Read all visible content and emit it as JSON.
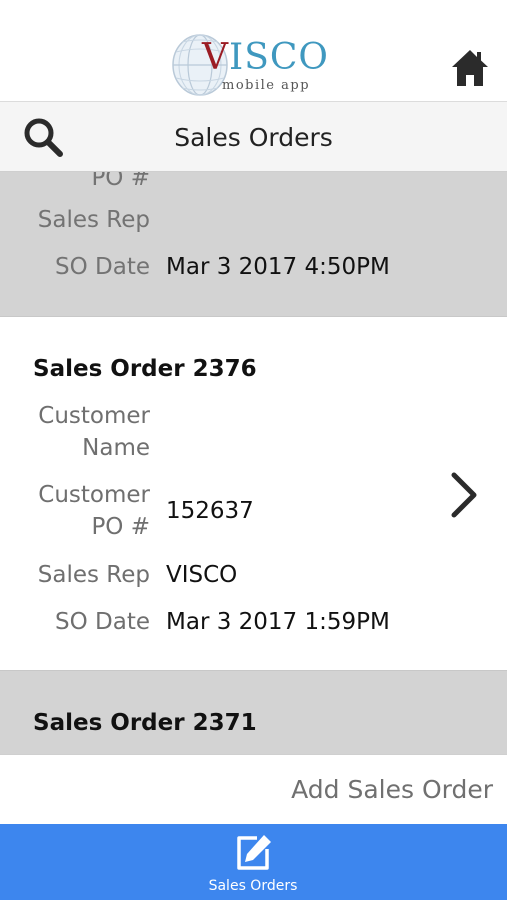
{
  "header": {
    "logo_main_first": "V",
    "logo_main_rest": "ISCO",
    "logo_sub": "mobile app",
    "home_icon": "home-icon"
  },
  "titlebar": {
    "title": "Sales Orders",
    "search_icon": "search-icon"
  },
  "orders": [
    {
      "title": "",
      "labels": {
        "po": "PO #",
        "rep": "Sales Rep",
        "date": "SO Date"
      },
      "values": {
        "po": "",
        "rep": "",
        "date": "Mar 3 2017 4:50PM"
      }
    },
    {
      "title": "Sales Order 2376",
      "labels": {
        "customer_line1": "Customer",
        "customer_line2": "Name",
        "po_line1": "Customer",
        "po_line2": "PO #",
        "rep": "Sales Rep",
        "date": "SO Date"
      },
      "values": {
        "customer": "",
        "po": "152637",
        "rep": "VISCO",
        "date": "Mar 3 2017 1:59PM"
      }
    },
    {
      "title": "Sales Order 2371"
    }
  ],
  "actions": {
    "add_label": "Add Sales Order"
  },
  "bottom_nav": {
    "items": [
      {
        "label": "Sales Orders",
        "icon": "edit-icon"
      }
    ]
  },
  "colors": {
    "accent": "#3d86ee",
    "logo_red": "#9b1c24",
    "logo_blue": "#3f98bf",
    "row_grey": "#d3d3d3"
  }
}
